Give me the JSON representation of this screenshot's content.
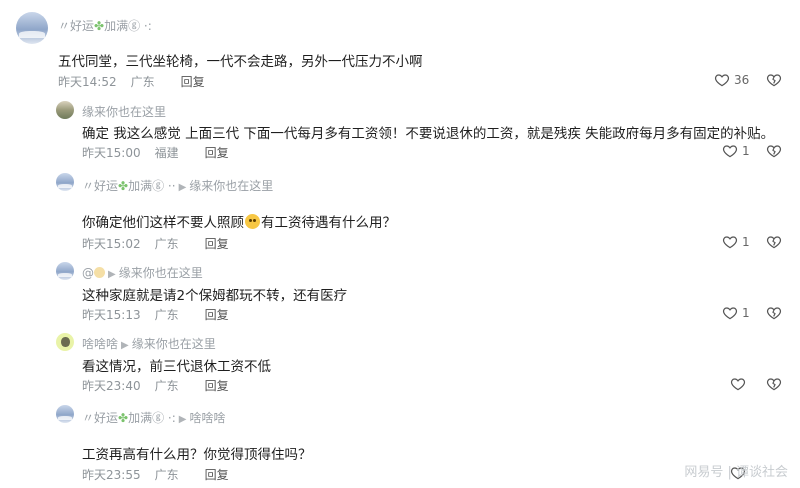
{
  "comments": [
    {
      "user": "好运",
      "user_suffix": "加满",
      "reply_to": "",
      "text": "五代同堂，三代坐轮椅，一代不会走路，另外一代压力不小啊",
      "time": "昨天14:52",
      "location": "广东",
      "reply_label": "回复",
      "likes": "36"
    },
    {
      "user": "缘来你也在这里",
      "user_suffix": "",
      "reply_to": "",
      "text": "确定 我这么感觉 上面三代 下面一代每月多有工资领！不要说退休的工资，就是残疾 失能政府每月多有固定的补贴。",
      "time": "昨天15:00",
      "location": "福建",
      "reply_label": "回复",
      "likes": "1"
    },
    {
      "user": "好运",
      "user_suffix": "加满",
      "reply_to": "缘来你也在这里",
      "text_before": "你确定他们这样不要人照顾",
      "text_after": "有工资待遇有什么用？",
      "time": "昨天15:02",
      "location": "广东",
      "reply_label": "回复",
      "likes": "1"
    },
    {
      "user": "@",
      "user_suffix": "",
      "reply_to": "缘来你也在这里",
      "text": "这种家庭就是请2个保姆都玩不转，还有医疗",
      "time": "昨天15:13",
      "location": "广东",
      "reply_label": "回复",
      "likes": "1"
    },
    {
      "user": "啥啥啥",
      "user_suffix": "",
      "reply_to": "缘来你也在这里",
      "text": "看这情况，前三代退休工资不低",
      "time": "昨天23:40",
      "location": "广东",
      "reply_label": "回复",
      "likes": ""
    },
    {
      "user": "好运",
      "user_suffix": "加满",
      "reply_to": "啥啥啥",
      "text": "工资再高有什么用？你觉得顶得住吗？",
      "time": "昨天23:55",
      "location": "广东",
      "reply_label": "回复",
      "likes": ""
    }
  ],
  "watermark": "网易号 | 谭谈社会"
}
